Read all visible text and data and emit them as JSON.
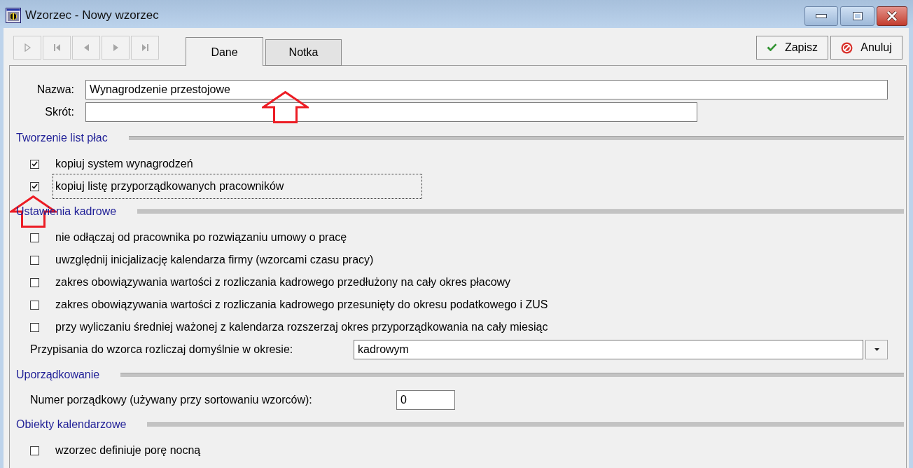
{
  "window": {
    "title": "Wzorzec - Nowy wzorzec"
  },
  "navigation": [
    {
      "kind": "new",
      "disabled": true
    },
    {
      "kind": "first",
      "disabled": true
    },
    {
      "kind": "prev",
      "disabled": true
    },
    {
      "kind": "next",
      "disabled": true
    },
    {
      "kind": "last",
      "disabled": true
    }
  ],
  "tabs": [
    {
      "label": "Dane",
      "selected": true
    },
    {
      "label": "Notka",
      "selected": false
    }
  ],
  "actions": [
    {
      "kind": "save",
      "label": "Zapisz"
    },
    {
      "kind": "cancel",
      "label": "Anuluj"
    }
  ],
  "fields": [
    {
      "label": "Nazwa:",
      "value": "Wynagrodzenie przestojowe"
    },
    {
      "label": "Skrót:"
    }
  ],
  "sections": [
    {
      "title": "Tworzenie list płac",
      "items": [
        {
          "kind": "checkbox",
          "label": "kopiuj system wynagrodzeń",
          "checked": true,
          "focused": false
        },
        {
          "kind": "checkbox",
          "label": "kopiuj listę przyporządkowanych pracowników",
          "checked": true,
          "focused": true
        }
      ]
    },
    {
      "title": "Ustawienia kadrowe",
      "items": [
        {
          "kind": "checkbox",
          "label": "nie odłączaj od pracownika po rozwiązaniu umowy o pracę",
          "checked": false,
          "focused": false
        },
        {
          "kind": "checkbox",
          "label": "uwzględnij inicjalizację kalendarza firmy (wzorcami czasu pracy)",
          "checked": false,
          "focused": false
        },
        {
          "kind": "checkbox",
          "label": "zakres obowiązywania wartości z rozliczania kadrowego przedłużony na cały okres płacowy",
          "checked": false,
          "focused": false
        },
        {
          "kind": "checkbox",
          "label": "zakres obowiązywania wartości z rozliczania kadrowego przesunięty do okresu podatkowego i ZUS",
          "checked": false,
          "focused": false
        },
        {
          "kind": "checkbox",
          "label": "przy wyliczaniu średniej ważonej z kalendarza rozszerzaj okres przyporządkowania na cały miesiąc",
          "checked": false,
          "focused": false
        },
        {
          "kind": "combo",
          "label": "Przypisania do wzorca rozliczaj domyślnie w okresie:",
          "value": "kadrowym"
        }
      ]
    },
    {
      "title": "Uporządkowanie",
      "items": [
        {
          "kind": "number",
          "label": "Numer porządkowy (używany przy sortowaniu wzorców):",
          "value": "0"
        }
      ]
    },
    {
      "title": "Obiekty kalendarzowe",
      "items": [
        {
          "kind": "checkbox",
          "label": "wzorzec definiuje porę nocną",
          "checked": false,
          "focused": false
        }
      ]
    }
  ]
}
